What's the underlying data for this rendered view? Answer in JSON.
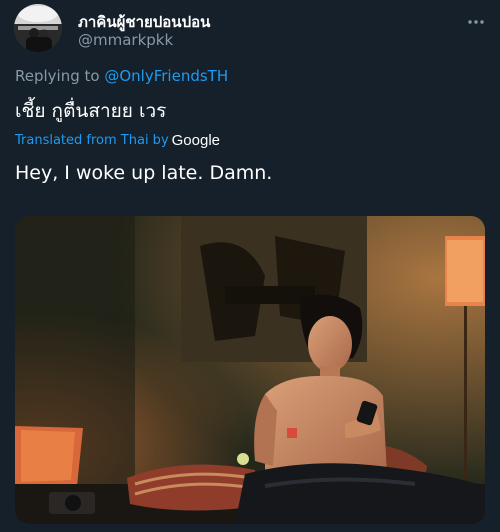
{
  "tweet": {
    "display_name": "ภาคินผู้ชายปอนปอน",
    "handle": "@mmarkpkk",
    "replying_prefix": "Replying to",
    "replying_to": "@OnlyFriendsTH",
    "text": "เชี้ย กูตื่นสายย เวร",
    "translated_label": "Translated from Thai by",
    "translator_brand": "Google",
    "translation": "Hey, I woke up late. Damn."
  },
  "icons": {
    "more": "more-horizontal-icon",
    "avatar": "profile-photo"
  },
  "colors": {
    "background": "#15202b",
    "accent": "#1d9bf0",
    "secondary_text": "#8899a6",
    "primary_text": "#ffffff"
  }
}
